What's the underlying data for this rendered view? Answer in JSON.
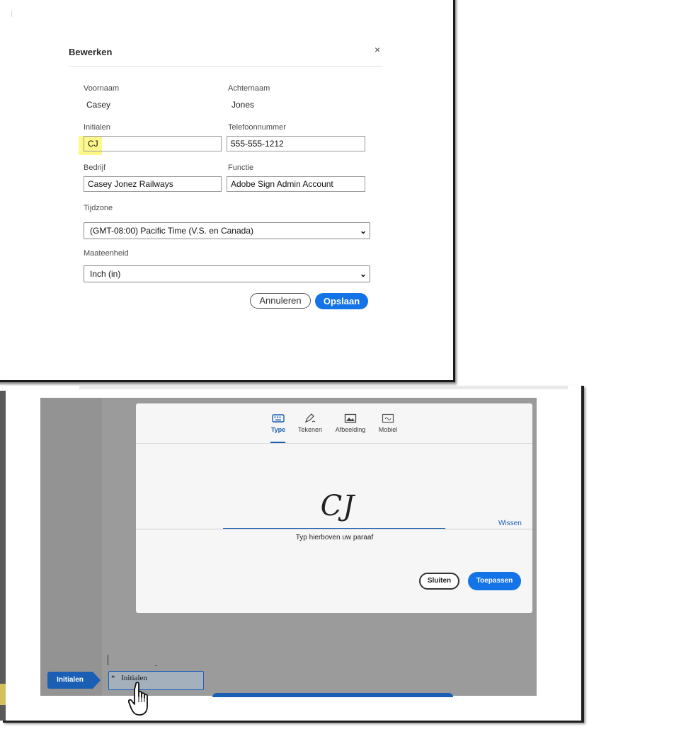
{
  "edit_dialog": {
    "title": "Bewerken",
    "close_glyph": "×",
    "first_name": {
      "label": "Voornaam",
      "value": "Casey"
    },
    "last_name": {
      "label": "Achternaam",
      "value": "Jones"
    },
    "initials": {
      "label": "Initialen",
      "value": "CJ"
    },
    "phone": {
      "label": "Telefoonnummer",
      "value": "555-555-1212"
    },
    "company": {
      "label": "Bedrijf",
      "value": "Casey Jonez Railways"
    },
    "function": {
      "label": "Functie",
      "value": "Adobe Sign Admin Account"
    },
    "timezone": {
      "label": "Tijdzone",
      "selected": "(GMT-08:00) Pacific Time (V.S. en Canada)"
    },
    "unit": {
      "label": "Maateenheid",
      "selected": "Inch (in)"
    },
    "cancel_label": "Annuleren",
    "save_label": "Opslaan",
    "highlight_color": "#fdf88a"
  },
  "signature_modal": {
    "tabs": [
      {
        "label": "Type",
        "icon": "keyboard-icon",
        "active": true
      },
      {
        "label": "Tekenen",
        "icon": "pen-draw-icon",
        "active": false
      },
      {
        "label": "Afbeelding",
        "icon": "image-icon",
        "active": false
      },
      {
        "label": "Mobiel",
        "icon": "mobile-icon",
        "active": false
      }
    ],
    "typed_initials": "CJ",
    "clear_label": "Wissen",
    "hint": "Typ hierboven uw paraaf",
    "close_label": "Sluiten",
    "apply_label": "Toepassen",
    "accent_color": "#1473e6"
  },
  "document": {
    "field_tag_label": "Initialen",
    "field_required_marker": "*",
    "field_placeholder": "Initialen",
    "cursor_icon": "hand-pointer-icon"
  }
}
